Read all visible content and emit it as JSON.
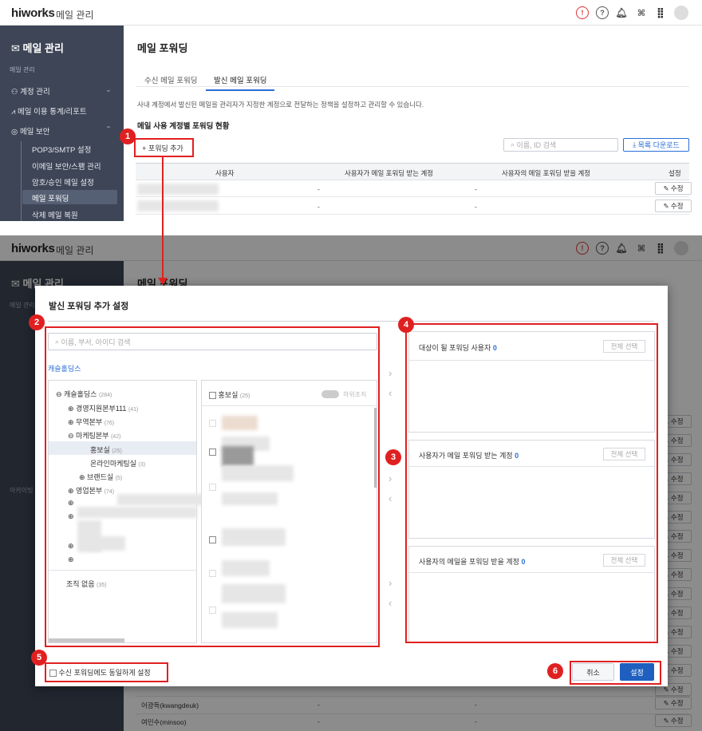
{
  "top": {
    "logo": "hiworks",
    "app_title": "메일 관리"
  },
  "sidebar": {
    "title": "메일 관리",
    "section": "메일 관리",
    "items": [
      {
        "label": "계정 관리"
      },
      {
        "label": "메일 이용 통계/리포트"
      },
      {
        "label": "메일 보안"
      }
    ],
    "subitems": [
      {
        "label": "POP3/SMTP 설정"
      },
      {
        "label": "이메일 보안/스팸 관리"
      },
      {
        "label": "암호/승인 메일 설정"
      },
      {
        "label": "메일 포워딩"
      },
      {
        "label": "삭제 메일 복원"
      }
    ],
    "archive_section": "아카이빙"
  },
  "page": {
    "title": "메일 포워딩",
    "tabs": [
      {
        "label": "수신 메일 포워딩"
      },
      {
        "label": "발신 메일 포워딩"
      }
    ],
    "description": "사내 계정에서 발신된 메일을 관리자가 지정한 계정으로 전달하는 정책을 설정하고 관리할 수 있습니다.",
    "section_title": "메일 사용 계정별 포워딩 현황",
    "add_button": "+ 포워딩 추가",
    "search_placeholder": "이름, ID 검색",
    "download_button": "목록 다운로드",
    "table": {
      "headers": [
        "사용자",
        "사용자가 메일 포워딩 받는 계정",
        "사용자의 메일 포워딩 받을 계정",
        "설정"
      ],
      "dash": "-",
      "edit": "수정",
      "bottom_rows": [
        {
          "user": "어광득(kwangdeuk)"
        },
        {
          "user": "여민수(minsoo)"
        }
      ]
    }
  },
  "modal": {
    "title": "발신 포워딩 추가 설정",
    "search_placeholder": "이름, 부서, 아이디 검색",
    "company": "캐슬홀딩스",
    "tree": {
      "root": "캐슬홀딩스",
      "root_count": "(284)",
      "nodes": [
        {
          "label": "경영지원본부111",
          "count": "(41)"
        },
        {
          "label": "무역본부",
          "count": "(76)"
        },
        {
          "label": "마케팅본부",
          "count": "(42)"
        },
        {
          "label": "홍보실",
          "count": "(25)"
        },
        {
          "label": "온라인마케팅실",
          "count": "(3)"
        },
        {
          "label": "브랜드실",
          "count": "(5)"
        },
        {
          "label": "영업본부",
          "count": "(74)"
        }
      ],
      "no_org": "조직 없음",
      "no_org_count": "(35)"
    },
    "member_panel": {
      "title": "홍보실",
      "count": "(25)",
      "toggle_label": "하위조직"
    },
    "right_sections": [
      {
        "label": "대상이 될 포워딩 사용자",
        "count": "0",
        "button": "전체 선택"
      },
      {
        "label": "사용자가 메일 포워딩 받는 계정",
        "count": "0",
        "button": "전체 선택"
      },
      {
        "label": "사용자의 메일을 포워딩 받을 계정",
        "count": "0",
        "button": "전체 선택"
      }
    ],
    "same_setting": "수신 포워딩에도 동일하게 설정",
    "cancel": "취소",
    "confirm": "설정"
  },
  "markers": [
    "1",
    "2",
    "3",
    "4",
    "5",
    "6"
  ],
  "colors": {
    "accent": "#2a6fd6",
    "annotation": "#e02020",
    "sidebar": "#3d4556"
  }
}
